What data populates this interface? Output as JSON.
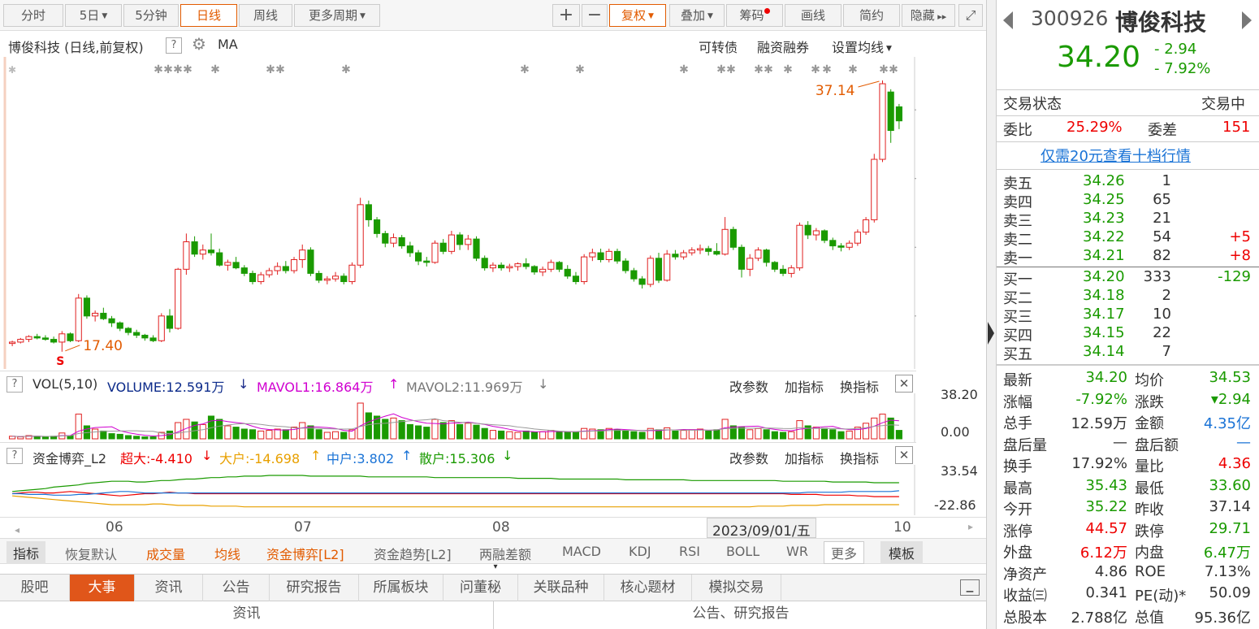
{
  "toolbar": {
    "periods": [
      "分时",
      "5日",
      "5分钟",
      "日线",
      "周线",
      "更多周期"
    ],
    "buttons": [
      "复权",
      "叠加",
      "筹码",
      "画线",
      "简约",
      "隐藏"
    ]
  },
  "panel": {
    "title": "博俊科技 (日线,前复权)",
    "ma": "MA",
    "links": [
      "可转债",
      "融资融券",
      "设置均线"
    ]
  },
  "main_axis": [
    "35.00",
    "30.00",
    "25.00",
    "20.00"
  ],
  "annotations": {
    "high": "37.14",
    "low": "17.40",
    "marker": "S"
  },
  "vol": {
    "name": "VOL(5,10)",
    "volume": "VOLUME:12.591万",
    "mavol1": "MAVOL1:16.864万",
    "mavol2": "MAVOL2:11.969万",
    "ticks": [
      "38.20",
      "0.00"
    ]
  },
  "fund": {
    "name": "资金博弈_L2",
    "super": "超大:-4.410",
    "big": "大户:-14.698",
    "mid": "中户:3.802",
    "small": "散户:15.306",
    "ticks": [
      "33.54",
      "-22.86"
    ]
  },
  "panel_buttons": [
    "改参数",
    "加指标",
    "换指标"
  ],
  "date_axis": {
    "months": [
      "06",
      "07",
      "08",
      "10"
    ],
    "cursor": "2023/09/01/五"
  },
  "indicator_tabs": [
    "指标",
    "恢复默认",
    "成交量",
    "均线",
    "资金博弈[L2]",
    "资金趋势[L2]",
    "两融差额",
    "MACD",
    "KDJ",
    "RSI",
    "BOLL",
    "WR",
    "更多",
    "模板"
  ],
  "news_tabs": [
    "股吧",
    "大事",
    "资讯",
    "公告",
    "研究报告",
    "所属板块",
    "问董秘",
    "关联品种",
    "核心题材",
    "模拟交易"
  ],
  "news_footer": [
    "资讯",
    "公告、研究报告"
  ],
  "quote": {
    "code": "300926",
    "name": "博俊科技",
    "price": "34.20",
    "change": "- 2.94",
    "change_pct": "- 7.92%",
    "status_label": "交易状态",
    "status_value": "交易中",
    "weibi_label": "委比",
    "weibi": "25.29%",
    "weicha_label": "委差",
    "weicha": "151",
    "promo": "仅需20元查看十档行情",
    "sells": [
      {
        "label": "卖五",
        "price": "34.26",
        "vol": "1",
        "chg": ""
      },
      {
        "label": "卖四",
        "price": "34.25",
        "vol": "65",
        "chg": ""
      },
      {
        "label": "卖三",
        "price": "34.23",
        "vol": "21",
        "chg": ""
      },
      {
        "label": "卖二",
        "price": "34.22",
        "vol": "54",
        "chg": "+5"
      },
      {
        "label": "卖一",
        "price": "34.21",
        "vol": "82",
        "chg": "+8"
      }
    ],
    "buys": [
      {
        "label": "买一",
        "price": "34.20",
        "vol": "333",
        "chg": "-129"
      },
      {
        "label": "买二",
        "price": "34.18",
        "vol": "2",
        "chg": ""
      },
      {
        "label": "买三",
        "price": "34.17",
        "vol": "10",
        "chg": ""
      },
      {
        "label": "买四",
        "price": "34.15",
        "vol": "22",
        "chg": ""
      },
      {
        "label": "买五",
        "price": "34.14",
        "vol": "7",
        "chg": ""
      }
    ],
    "stats": [
      [
        "最新",
        "34.20",
        "均价",
        "34.53"
      ],
      [
        "涨幅",
        "-7.92%",
        "涨跌",
        "▾2.94"
      ],
      [
        "总手",
        "12.59万",
        "金额",
        "4.35亿"
      ],
      [
        "盘后量",
        "—",
        "盘后额",
        "—"
      ],
      [
        "换手",
        "17.92%",
        "量比",
        "4.36"
      ],
      [
        "最高",
        "35.43",
        "最低",
        "33.60"
      ],
      [
        "今开",
        "35.22",
        "昨收",
        "37.14"
      ],
      [
        "涨停",
        "44.57",
        "跌停",
        "29.71"
      ],
      [
        "外盘",
        "6.12万",
        "内盘",
        "6.47万"
      ],
      [
        "净资产",
        "4.86",
        "ROE",
        "7.13%"
      ],
      [
        "收益㈢",
        "0.341",
        "PE(动)*",
        "50.09"
      ],
      [
        "总股本",
        "2.788亿",
        "总值",
        "95.36亿"
      ]
    ],
    "stat_colors": [
      [
        "green",
        "green"
      ],
      [
        "green",
        "green"
      ],
      [
        "dark",
        "blue"
      ],
      [
        "dark",
        "blue"
      ],
      [
        "dark",
        "red"
      ],
      [
        "green",
        "green"
      ],
      [
        "green",
        "dark"
      ],
      [
        "red",
        "green"
      ],
      [
        "red",
        "green"
      ],
      [
        "dark",
        "dark"
      ],
      [
        "dark",
        "dark"
      ],
      [
        "dark",
        "dark"
      ]
    ]
  },
  "colors": {
    "up": "#e02020",
    "down": "#1a9a00",
    "accent": "#e25b00"
  },
  "chart_data": {
    "type": "candlestick",
    "ylim": [
      16.5,
      38.5
    ],
    "candles": [
      [
        18.0,
        18.2,
        17.8,
        18.1
      ],
      [
        18.1,
        18.4,
        18.0,
        18.3
      ],
      [
        18.3,
        18.6,
        18.1,
        18.5
      ],
      [
        18.5,
        18.7,
        18.3,
        18.4
      ],
      [
        18.4,
        18.6,
        18.2,
        18.3
      ],
      [
        18.3,
        18.5,
        18.0,
        18.1
      ],
      [
        18.1,
        18.9,
        17.4,
        18.7
      ],
      [
        18.7,
        18.8,
        18.1,
        18.2
      ],
      [
        18.2,
        21.6,
        18.1,
        21.3
      ],
      [
        21.3,
        21.5,
        19.8,
        20.0
      ],
      [
        20.0,
        20.4,
        19.6,
        20.2
      ],
      [
        20.2,
        20.6,
        19.7,
        19.8
      ],
      [
        19.8,
        20.0,
        19.2,
        19.5
      ],
      [
        19.5,
        19.6,
        18.9,
        19.1
      ],
      [
        19.1,
        19.2,
        18.6,
        18.8
      ],
      [
        18.8,
        19.0,
        18.4,
        18.6
      ],
      [
        18.6,
        18.7,
        18.2,
        18.4
      ],
      [
        18.4,
        18.6,
        18.1,
        18.2
      ],
      [
        18.2,
        20.2,
        18.1,
        20.0
      ],
      [
        20.0,
        20.5,
        18.8,
        19.1
      ],
      [
        19.1,
        23.5,
        19.0,
        23.4
      ],
      [
        23.4,
        26.0,
        23.0,
        25.4
      ],
      [
        25.4,
        25.8,
        24.3,
        24.5
      ],
      [
        24.5,
        25.2,
        24.1,
        24.8
      ],
      [
        24.8,
        26.0,
        24.4,
        24.6
      ],
      [
        24.6,
        24.9,
        23.6,
        23.7
      ],
      [
        23.7,
        24.1,
        23.3,
        23.9
      ],
      [
        23.9,
        24.3,
        23.4,
        23.5
      ],
      [
        23.5,
        23.7,
        22.9,
        23.1
      ],
      [
        23.1,
        23.3,
        22.3,
        22.5
      ],
      [
        22.5,
        23.2,
        22.3,
        23.0
      ],
      [
        23.0,
        23.5,
        22.8,
        23.3
      ],
      [
        23.3,
        23.9,
        23.0,
        23.6
      ],
      [
        23.6,
        24.0,
        23.1,
        23.3
      ],
      [
        23.3,
        24.3,
        23.1,
        24.1
      ],
      [
        24.1,
        25.2,
        23.5,
        24.8
      ],
      [
        24.8,
        25.0,
        22.9,
        23.1
      ],
      [
        23.1,
        23.3,
        22.4,
        22.6
      ],
      [
        22.6,
        22.9,
        22.3,
        22.7
      ],
      [
        22.7,
        23.2,
        22.5,
        22.9
      ],
      [
        22.9,
        23.1,
        22.3,
        22.5
      ],
      [
        22.5,
        23.9,
        22.3,
        23.7
      ],
      [
        23.7,
        28.6,
        23.5,
        28.1
      ],
      [
        28.1,
        28.4,
        26.5,
        27.0
      ],
      [
        27.0,
        27.2,
        25.7,
        26.0
      ],
      [
        26.0,
        26.2,
        25.0,
        25.3
      ],
      [
        25.3,
        26.0,
        25.0,
        25.7
      ],
      [
        25.7,
        25.9,
        24.9,
        25.1
      ],
      [
        25.1,
        25.4,
        24.3,
        24.6
      ],
      [
        24.6,
        24.8,
        23.7,
        24.0
      ],
      [
        24.0,
        24.3,
        23.6,
        23.9
      ],
      [
        23.9,
        25.5,
        23.8,
        25.3
      ],
      [
        25.3,
        25.6,
        24.5,
        24.7
      ],
      [
        24.7,
        26.2,
        24.5,
        25.9
      ],
      [
        25.9,
        26.1,
        24.8,
        25.2
      ],
      [
        25.2,
        25.9,
        24.8,
        25.6
      ],
      [
        25.6,
        25.8,
        24.0,
        24.2
      ],
      [
        24.2,
        24.4,
        23.3,
        23.5
      ],
      [
        23.5,
        23.9,
        23.2,
        23.7
      ],
      [
        23.7,
        23.9,
        23.3,
        23.5
      ],
      [
        23.5,
        23.8,
        23.2,
        23.6
      ],
      [
        23.6,
        23.9,
        23.3,
        23.8
      ],
      [
        23.8,
        24.2,
        23.4,
        23.6
      ],
      [
        23.6,
        23.7,
        23.0,
        23.2
      ],
      [
        23.2,
        23.6,
        22.9,
        23.4
      ],
      [
        23.4,
        24.1,
        23.2,
        23.9
      ],
      [
        23.9,
        24.0,
        23.2,
        23.4
      ],
      [
        23.4,
        23.7,
        22.7,
        22.9
      ],
      [
        22.9,
        23.2,
        22.3,
        22.5
      ],
      [
        22.5,
        24.5,
        22.3,
        24.3
      ],
      [
        24.3,
        24.9,
        24.0,
        24.6
      ],
      [
        24.6,
        24.9,
        23.9,
        24.1
      ],
      [
        24.1,
        24.9,
        23.9,
        24.7
      ],
      [
        24.7,
        24.9,
        23.8,
        24.0
      ],
      [
        24.0,
        24.2,
        23.1,
        23.3
      ],
      [
        23.3,
        23.5,
        22.5,
        22.7
      ],
      [
        22.7,
        22.9,
        22.0,
        22.3
      ],
      [
        22.3,
        24.4,
        22.1,
        24.2
      ],
      [
        24.2,
        24.6,
        22.4,
        22.6
      ],
      [
        22.6,
        24.8,
        22.5,
        24.5
      ],
      [
        24.5,
        24.8,
        24.1,
        24.3
      ],
      [
        24.3,
        24.8,
        24.1,
        24.6
      ],
      [
        24.6,
        25.0,
        24.4,
        24.8
      ],
      [
        24.8,
        25.2,
        24.5,
        24.9
      ],
      [
        24.9,
        25.1,
        24.4,
        24.7
      ],
      [
        24.7,
        25.3,
        24.4,
        24.5
      ],
      [
        24.5,
        27.2,
        24.4,
        26.3
      ],
      [
        26.3,
        26.5,
        24.8,
        25.0
      ],
      [
        25.0,
        25.2,
        22.8,
        23.4
      ],
      [
        23.4,
        24.5,
        22.9,
        24.2
      ],
      [
        24.2,
        25.0,
        24.0,
        24.8
      ],
      [
        24.8,
        24.9,
        23.6,
        23.9
      ],
      [
        23.9,
        24.0,
        23.2,
        23.4
      ],
      [
        23.4,
        23.7,
        22.9,
        23.1
      ],
      [
        23.1,
        23.7,
        22.8,
        23.5
      ],
      [
        23.5,
        26.8,
        23.3,
        26.6
      ],
      [
        26.6,
        26.9,
        25.6,
        25.9
      ],
      [
        25.9,
        26.4,
        25.5,
        26.2
      ],
      [
        26.2,
        26.3,
        25.3,
        25.5
      ],
      [
        25.5,
        25.7,
        24.8,
        25.1
      ],
      [
        25.1,
        25.3,
        24.7,
        25.0
      ],
      [
        25.0,
        25.5,
        24.8,
        25.3
      ],
      [
        25.3,
        26.3,
        25.1,
        26.1
      ],
      [
        26.1,
        27.2,
        25.9,
        27.0
      ],
      [
        27.0,
        31.8,
        26.8,
        31.4
      ],
      [
        31.4,
        37.14,
        31.2,
        36.9
      ],
      [
        36.3,
        36.5,
        32.6,
        33.5
      ],
      [
        35.22,
        35.43,
        33.6,
        34.2
      ]
    ],
    "volume": [
      4,
      3,
      5,
      4,
      3,
      4,
      9,
      5,
      38,
      20,
      15,
      12,
      8,
      7,
      5,
      4,
      3,
      3,
      10,
      12,
      25,
      30,
      26,
      22,
      35,
      30,
      20,
      18,
      15,
      14,
      12,
      13,
      15,
      14,
      18,
      25,
      20,
      14,
      10,
      11,
      10,
      14,
      55,
      40,
      35,
      30,
      32,
      28,
      22,
      20,
      18,
      30,
      25,
      28,
      22,
      24,
      21,
      16,
      13,
      12,
      11,
      10,
      12,
      10,
      11,
      13,
      11,
      10,
      10,
      16,
      15,
      14,
      16,
      14,
      12,
      11,
      10,
      16,
      14,
      17,
      12,
      13,
      14,
      15,
      12,
      14,
      30,
      20,
      18,
      14,
      16,
      14,
      11,
      10,
      11,
      28,
      20,
      18,
      16,
      14,
      11,
      12,
      18,
      24,
      32,
      38,
      32,
      13
    ],
    "fund": {
      "super": [
        0,
        1,
        2,
        2,
        1,
        1,
        2,
        3,
        2,
        1,
        0,
        -1,
        -2,
        -3,
        -2,
        -1,
        0,
        0,
        1,
        2,
        1,
        1,
        0,
        0,
        0,
        0,
        0,
        0,
        0,
        0,
        0,
        0,
        0,
        0,
        0,
        0,
        0,
        0,
        0,
        0,
        0,
        0,
        0,
        0,
        0,
        0,
        0,
        0,
        0,
        0,
        0,
        0,
        0,
        0,
        0,
        0,
        0,
        0,
        0,
        0,
        0,
        0,
        0,
        0,
        0,
        0,
        0,
        0,
        0,
        0,
        0,
        0,
        0,
        0,
        0,
        0,
        0,
        0,
        0,
        0,
        0,
        0,
        0,
        0,
        0,
        0,
        0,
        0,
        0,
        0,
        0,
        0,
        0,
        0,
        -1,
        -1,
        -1,
        -1,
        -2,
        -2,
        -2,
        -2,
        -3,
        -3,
        -4,
        -4,
        -4,
        -4
      ],
      "big": [
        -3,
        -4,
        -5,
        -6,
        -7,
        -8,
        -9,
        -10,
        -11,
        -12,
        -13,
        -14,
        -15,
        -15,
        -15,
        -15,
        -15,
        -14,
        -14,
        -15,
        -16,
        -16,
        -16,
        -16,
        -17,
        -17,
        -17,
        -17,
        -18,
        -18,
        -18,
        -18,
        -18,
        -18,
        -18,
        -18,
        -18,
        -18,
        -18,
        -18,
        -18,
        -18,
        -18,
        -18,
        -18,
        -18,
        -18,
        -18,
        -18,
        -18,
        -18,
        -18,
        -18,
        -18,
        -18,
        -18,
        -18,
        -18,
        -18,
        -18,
        -18,
        -18,
        -18,
        -18,
        -18,
        -18,
        -18,
        -18,
        -18,
        -18,
        -18,
        -18,
        -18,
        -18,
        -18,
        -18,
        -18,
        -18,
        -18,
        -18,
        -18,
        -18,
        -18,
        -18,
        -18,
        -18,
        -18,
        -18,
        -18,
        -18,
        -17,
        -17,
        -17,
        -17,
        -16,
        -16,
        -16,
        -16,
        -15,
        -15,
        -15,
        -15,
        -15,
        -15,
        -15,
        -15,
        -15,
        -15
      ],
      "mid": [
        0,
        0,
        -1,
        -1,
        -1,
        -2,
        -2,
        -2,
        -1,
        -1,
        0,
        1,
        2,
        3,
        3,
        2,
        1,
        1,
        1,
        1,
        1,
        1,
        1,
        1,
        1,
        1,
        1,
        1,
        1,
        1,
        1,
        1,
        1,
        1,
        1,
        1,
        1,
        1,
        1,
        1,
        1,
        1,
        1,
        1,
        1,
        1,
        1,
        1,
        1,
        1,
        1,
        1,
        1,
        1,
        1,
        1,
        1,
        1,
        1,
        1,
        1,
        1,
        1,
        1,
        1,
        1,
        1,
        1,
        1,
        1,
        1,
        1,
        1,
        1,
        1,
        1,
        1,
        1,
        1,
        1,
        1,
        1,
        1,
        1,
        1,
        1,
        1,
        1,
        1,
        1,
        1,
        1,
        1,
        1,
        1,
        1,
        2,
        2,
        2,
        2,
        2,
        3,
        3,
        3,
        3,
        3,
        3,
        4
      ],
      "small": [
        3,
        4,
        5,
        6,
        7,
        9,
        10,
        11,
        12,
        14,
        15,
        16,
        17,
        17,
        17,
        16,
        16,
        17,
        18,
        18,
        19,
        20,
        20,
        21,
        22,
        22,
        23,
        23,
        24,
        24,
        24,
        25,
        25,
        25,
        25,
        25,
        24,
        24,
        24,
        24,
        24,
        24,
        24,
        23,
        23,
        23,
        23,
        23,
        23,
        23,
        23,
        22,
        22,
        22,
        22,
        22,
        22,
        22,
        22,
        22,
        22,
        21,
        21,
        21,
        21,
        21,
        20,
        20,
        20,
        20,
        20,
        20,
        20,
        20,
        19,
        19,
        19,
        19,
        19,
        19,
        19,
        19,
        18,
        18,
        18,
        18,
        18,
        18,
        18,
        18,
        18,
        18,
        18,
        17,
        17,
        17,
        17,
        17,
        17,
        16,
        16,
        16,
        16,
        16,
        15,
        15,
        15,
        15
      ]
    }
  }
}
